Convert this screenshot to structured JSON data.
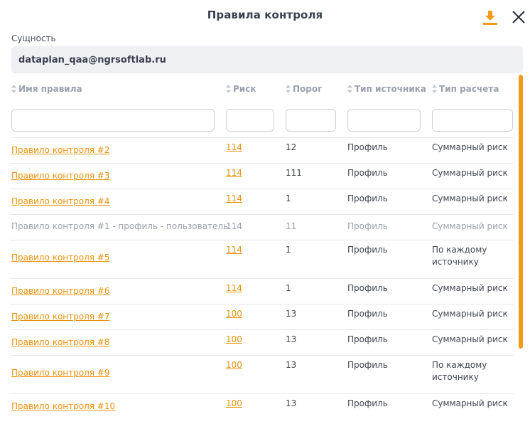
{
  "dialog": {
    "title": "Правила контроля",
    "download_icon": "download-icon",
    "close_icon": "close-icon",
    "accent_color": "#f29a1a"
  },
  "entity": {
    "label": "Сущность",
    "value": "dataplan_qaa@ngrsoftlab.ru"
  },
  "columns": [
    "Имя правила",
    "Риск",
    "Порог",
    "Тип источника",
    "Тип расчета"
  ],
  "filters": [
    "",
    "",
    "",
    "",
    ""
  ],
  "rows": [
    {
      "name": "Правило контроля #2",
      "risk": "114",
      "threshold": "12",
      "source": "Профиль",
      "calc": "Суммарный риск",
      "active": true
    },
    {
      "name": "Правило контроля #3",
      "risk": "114",
      "threshold": "111",
      "source": "Профиль",
      "calc": "Суммарный риск",
      "active": true
    },
    {
      "name": "Правило контроля #4",
      "risk": "114",
      "threshold": "1",
      "source": "Профиль",
      "calc": "Суммарный риск",
      "active": true
    },
    {
      "name": "Правило контроля #1 - профиль - пользователь",
      "risk": "114",
      "threshold": "11",
      "source": "Профиль",
      "calc": "Суммарный риск",
      "active": false
    },
    {
      "name": "Правило контроля #5",
      "risk": "114",
      "threshold": "1",
      "source": "Профиль",
      "calc": "По каждому источнику",
      "active": true
    },
    {
      "name": "Правило контроля #6",
      "risk": "114",
      "threshold": "1",
      "source": "Профиль",
      "calc": "Суммарный риск",
      "active": true
    },
    {
      "name": "Правило контроля #7",
      "risk": "100",
      "threshold": "13",
      "source": "Профиль",
      "calc": "Суммарный риск",
      "active": true
    },
    {
      "name": "Правило контроля #8",
      "risk": "100",
      "threshold": "13",
      "source": "Профиль",
      "calc": "Суммарный риск",
      "active": true
    },
    {
      "name": "Правило контроля #9",
      "risk": "100",
      "threshold": "13",
      "source": "Профиль",
      "calc": "По каждому источнику",
      "active": true
    },
    {
      "name": "Правило контроля #10",
      "risk": "100",
      "threshold": "13",
      "source": "Профиль",
      "calc": "Суммарный риск",
      "active": true
    }
  ]
}
